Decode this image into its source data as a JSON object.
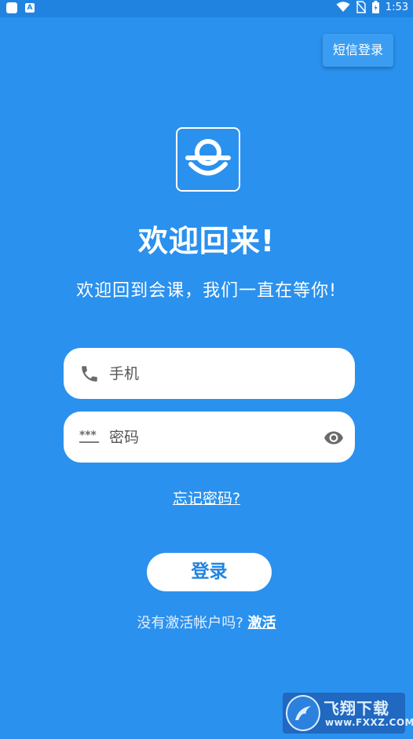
{
  "status_bar": {
    "time": "1:53",
    "left_icons": [
      "app-square-icon",
      "a-icon"
    ],
    "right_icons": [
      "wifi-icon",
      "no-sim-icon",
      "battery-icon"
    ]
  },
  "header": {
    "sms_login_label": "短信登录"
  },
  "welcome": {
    "title": "欢迎回来!",
    "subtitle": "欢迎回到会课，我们一直在等你!"
  },
  "form": {
    "phone_placeholder": "手机",
    "phone_icon": "phone-icon",
    "password_placeholder": "密码",
    "password_icon": "password-dots-icon",
    "visibility_icon": "eye-icon",
    "forgot_label": "忘记密码?",
    "login_label": "登录",
    "activate_prompt": "没有激活帐户吗?",
    "activate_label": "激活"
  },
  "watermark": {
    "title": "飞翔下载",
    "url": "www.FXXZ.COM"
  },
  "colors": {
    "background": "#2a91ee",
    "status_bar": "#2183e0",
    "accent": "#2183e0",
    "field_bg": "#ffffff"
  }
}
